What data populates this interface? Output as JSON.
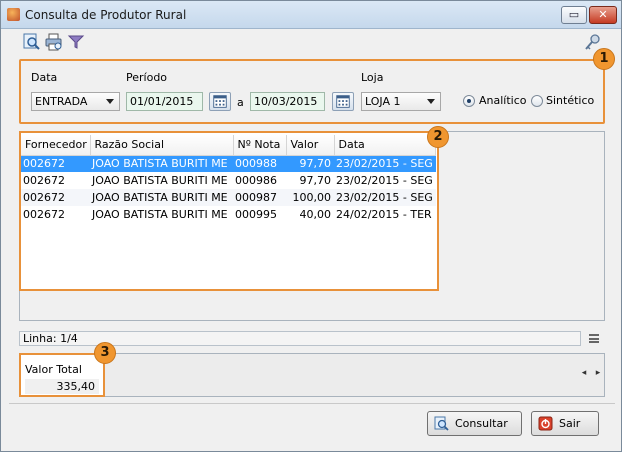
{
  "window": {
    "title": "Consulta de Produtor Rural",
    "restore_symbol": "▭",
    "close_symbol": "✕"
  },
  "filters": {
    "data_label": "Data",
    "periodo_label": "Período",
    "loja_label": "Loja",
    "data_value": "ENTRADA",
    "date_start": "01/01/2015",
    "date_sep": "a",
    "date_end": "10/03/2015",
    "loja_value": "LOJA 1",
    "radio_analitico": "Analítico",
    "radio_sintetico": "Sintético"
  },
  "badges": [
    "1",
    "2",
    "3"
  ],
  "table": {
    "columns": [
      "Fornecedor",
      "Razão Social",
      "Nº Nota",
      "Valor",
      "Data"
    ],
    "rows": [
      [
        "002672",
        "JOAO BATISTA BURITI ME",
        "000988",
        "97,70",
        "23/02/2015 - SEG"
      ],
      [
        "002672",
        "JOAO BATISTA BURITI ME",
        "000986",
        "97,70",
        "23/02/2015 - SEG"
      ],
      [
        "002672",
        "JOAO BATISTA BURITI ME",
        "000987",
        "100,00",
        "23/02/2015 - SEG"
      ],
      [
        "002672",
        "JOAO BATISTA BURITI ME",
        "000995",
        "40,00",
        "24/02/2015 - TER"
      ]
    ]
  },
  "status": {
    "linha": "Linha: 1/4"
  },
  "totals": {
    "label": "Valor Total",
    "value": "335,40"
  },
  "buttons": {
    "consultar": "Consultar",
    "sair": "Sair"
  },
  "colors": {
    "highlight": "#e8913a",
    "selection": "#3399ff",
    "date_bg": "#eaf7ee"
  },
  "icons": [
    "app-icon",
    "search-icon",
    "print-icon",
    "filter-icon",
    "key-icon",
    "calendar-icon",
    "consultar-icon",
    "sair-icon",
    "menu-icon"
  ]
}
